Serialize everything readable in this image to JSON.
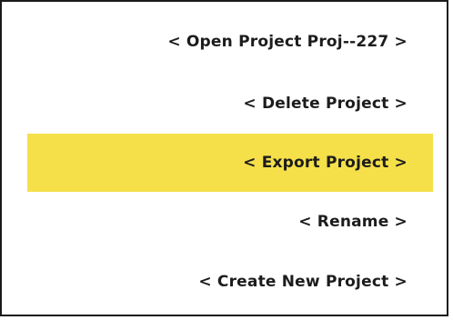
{
  "menu": {
    "items": [
      {
        "label": "< Open Project Proj--227 >",
        "selected": false
      },
      {
        "label": "< Delete Project >",
        "selected": false
      },
      {
        "label": "< Export Project >",
        "selected": true
      },
      {
        "label": "< Rename >",
        "selected": false
      },
      {
        "label": "< Create New Project >",
        "selected": false
      }
    ],
    "highlight_color": "#f5e04a",
    "border_color": "#1a1a1a",
    "text_color": "#1c1c1c"
  }
}
